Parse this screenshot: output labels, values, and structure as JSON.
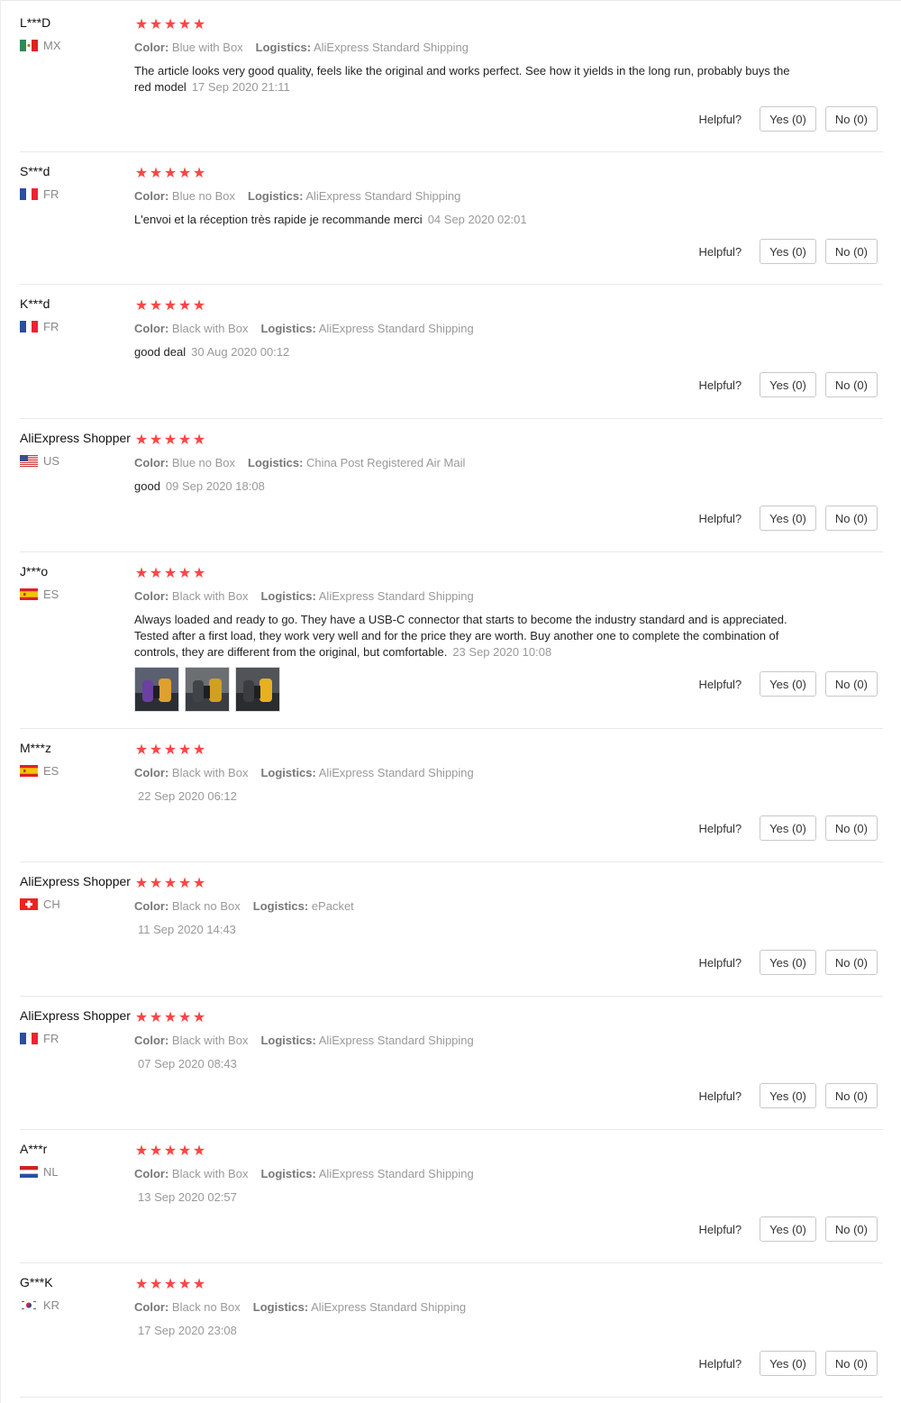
{
  "labels": {
    "color_key": "Color:",
    "logistics_key": "Logistics:",
    "helpful": "Helpful?",
    "yes": "Yes (0)",
    "no": "No (0)"
  },
  "colors": {
    "star": "#ff4747",
    "meta_text": "#999999",
    "divider": "#e8e8e8"
  },
  "reviews": [
    {
      "user": "L***D",
      "country": "MX",
      "flag": "flag-mx-icon",
      "stars": 5,
      "color": "Blue with Box",
      "logistics": "AliExpress Standard Shipping",
      "text": "The article looks very good quality, feels like the original and works perfect. See how it yields in the long run, probably buys the red model",
      "date": "17 Sep 2020 21:11"
    },
    {
      "user": "S***d",
      "country": "FR",
      "flag": "flag-fr-icon",
      "stars": 5,
      "color": "Blue no Box",
      "logistics": "AliExpress Standard Shipping",
      "text": "L'envoi et la réception très rapide je recommande merci",
      "date": "04 Sep 2020 02:01"
    },
    {
      "user": "K***d",
      "country": "FR",
      "flag": "flag-fr-icon",
      "stars": 5,
      "color": "Black with Box",
      "logistics": "AliExpress Standard Shipping",
      "text": "good deal",
      "date": "30 Aug 2020 00:12"
    },
    {
      "user": "AliExpress Shopper",
      "country": "US",
      "flag": "flag-us-icon",
      "stars": 5,
      "color": "Blue no Box",
      "logistics": "China Post Registered Air Mail",
      "text": "good",
      "date": "09 Sep 2020 18:08"
    },
    {
      "user": "J***o",
      "country": "ES",
      "flag": "flag-es-icon",
      "stars": 5,
      "color": "Black with Box",
      "logistics": "AliExpress Standard Shipping",
      "text": "Always loaded and ready to go. They have a USB-C connector that starts to become the industry standard and is appreciated. Tested after a first load, they work very well and for the price they are worth. Buy another one to complete the combination of controls, they are different from the original, but comfortable.",
      "date": "23 Sep 2020 10:08",
      "photos": [
        "review-photo-1",
        "review-photo-2",
        "review-photo-3"
      ]
    },
    {
      "user": "M***z",
      "country": "ES",
      "flag": "flag-es-icon",
      "stars": 5,
      "color": "Black with Box",
      "logistics": "AliExpress Standard Shipping",
      "text": "",
      "date": "22 Sep 2020 06:12"
    },
    {
      "user": "AliExpress Shopper",
      "country": "CH",
      "flag": "flag-ch-icon",
      "stars": 5,
      "color": "Black no Box",
      "logistics": "ePacket",
      "text": "",
      "date": "11 Sep 2020 14:43"
    },
    {
      "user": "AliExpress Shopper",
      "country": "FR",
      "flag": "flag-fr-icon",
      "stars": 5,
      "color": "Black with Box",
      "logistics": "AliExpress Standard Shipping",
      "text": "",
      "date": "07 Sep 2020 08:43"
    },
    {
      "user": "A***r",
      "country": "NL",
      "flag": "flag-nl-icon",
      "stars": 5,
      "color": "Black with Box",
      "logistics": "AliExpress Standard Shipping",
      "text": "",
      "date": "13 Sep 2020 02:57"
    },
    {
      "user": "G***K",
      "country": "KR",
      "flag": "flag-kr-icon",
      "stars": 5,
      "color": "Black no Box",
      "logistics": "AliExpress Standard Shipping",
      "text": "",
      "date": "17 Sep 2020 23:08"
    }
  ]
}
